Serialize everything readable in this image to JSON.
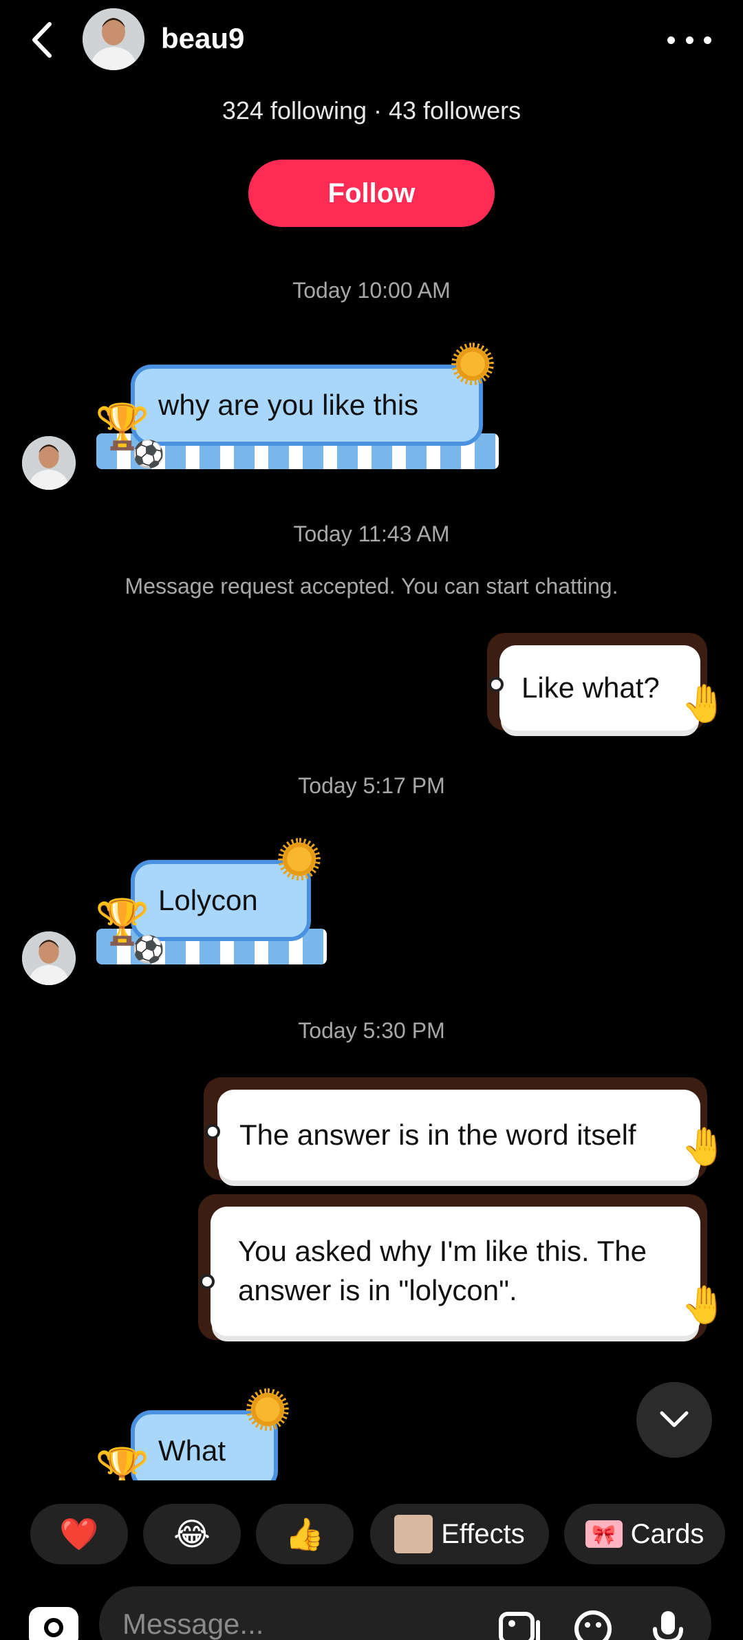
{
  "header": {
    "username": "beau9",
    "counts": "324 following · 43 followers",
    "follow_label": "Follow"
  },
  "conversation": {
    "ts1": "Today 10:00 AM",
    "msg1": "why are you like this",
    "ts2": "Today 11:43 AM",
    "system": "Message request accepted. You can start chatting.",
    "reply1": "Like what?",
    "ts3": "Today 5:17 PM",
    "msg2": "Lolycon",
    "ts4": "Today 5:30 PM",
    "reply2": "The answer is in the word itself",
    "reply3": "You asked why I'm like this. The answer is in \"lolycon\".",
    "msg3": "What"
  },
  "quick_replies": {
    "heart": "❤️",
    "laugh": "😂",
    "thumbs": "👍",
    "effects": "Effects",
    "cards": "Cards"
  },
  "composer": {
    "placeholder": "Message..."
  }
}
